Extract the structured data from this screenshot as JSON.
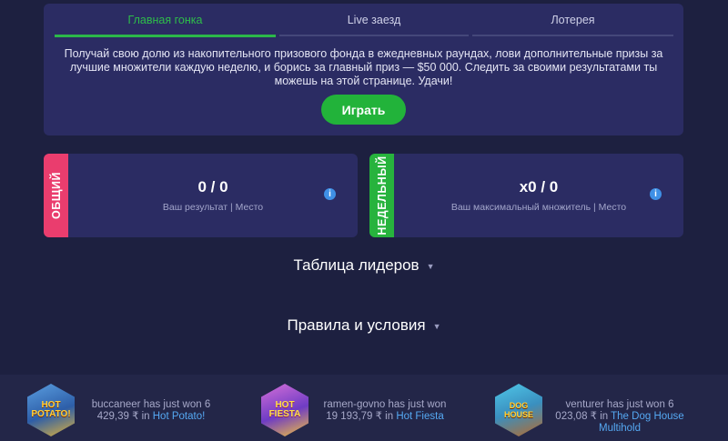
{
  "promo": {
    "tabs": [
      "Главная гонка",
      "Live заезд",
      "Лотерея"
    ],
    "text": "Получай свою долю из накопительного призового фонда в ежедневных раундах, лови дополнительные призы за лучшие множители каждую неделю, и борись за главный приз — $50 000. Следить за своими результатами ты можешь на этой странице. Удачи!",
    "play_label": "Играть"
  },
  "cards": [
    {
      "side_label": "ОБЩИЙ",
      "value": "0 / 0",
      "caption": "Ваш результат | Место",
      "accent": "#ea3d6e"
    },
    {
      "side_label": "НЕДЕЛЬНЫЙ",
      "value": "x0 / 0",
      "caption": "Ваш максимальный множитель | Место",
      "accent": "#27b33d"
    }
  ],
  "sections": {
    "leaderboard": "Таблица лидеров",
    "rules": "Правила и условия"
  },
  "winners": [
    {
      "user": "buccaneer",
      "amount": "6 429,39 ₹",
      "game": "Hot Potato!",
      "thumb_text": "HOT POTATO!",
      "icon": "hot-potato-game-icon"
    },
    {
      "user": "ramen-govno",
      "amount": "19 193,79 ₹",
      "game": "Hot Fiesta",
      "thumb_text": "HOT FIESTA",
      "icon": "hot-fiesta-game-icon"
    },
    {
      "user": "venturer",
      "amount": "6 023,08 ₹",
      "game": "The Dog House Multihold",
      "thumb_text": "DOG HOUSE",
      "icon": "dog-house-game-icon"
    }
  ],
  "texts": {
    "has_just_won": "has just won",
    "in": "in"
  },
  "colors": {
    "background": "#1d2040",
    "panel": "#2b2c63",
    "accent_green": "#22b33a",
    "accent_pink": "#ea3d6e",
    "link": "#55a8f2"
  }
}
